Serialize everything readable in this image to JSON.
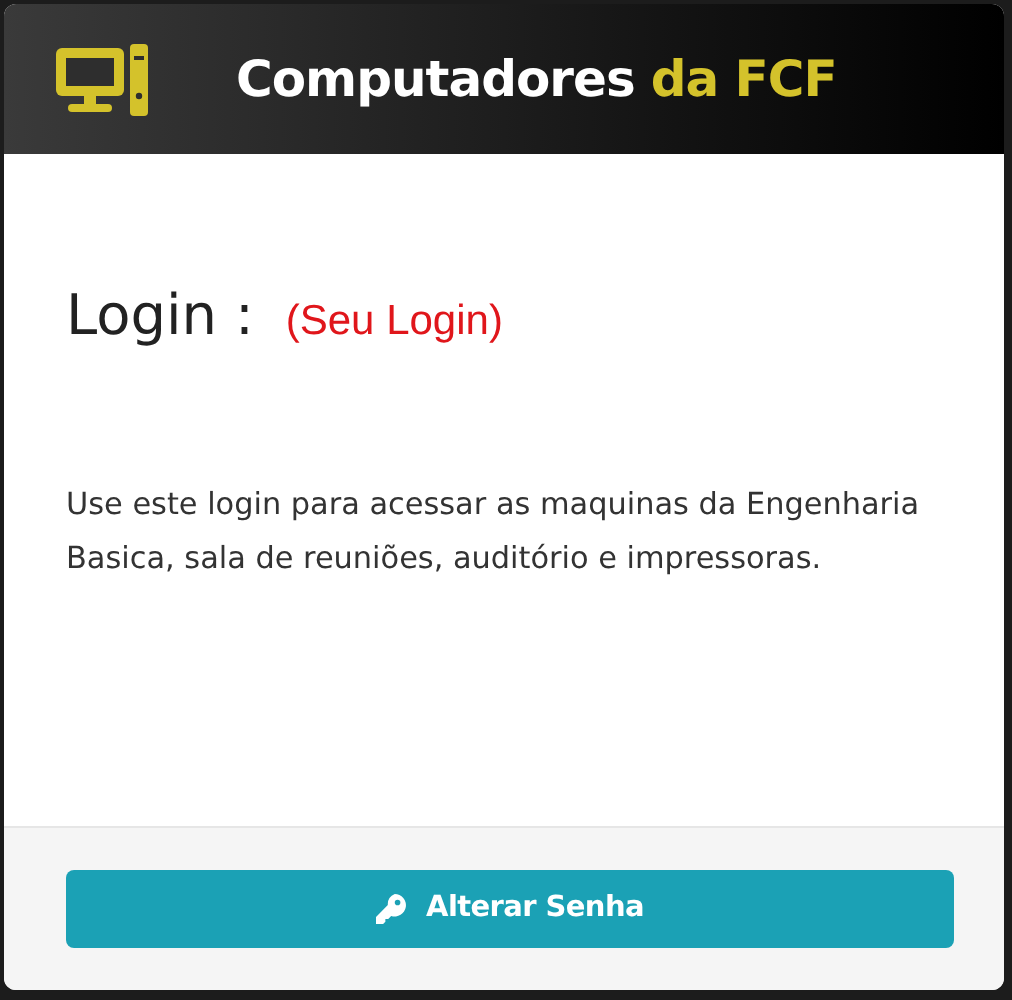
{
  "header": {
    "title": "Computadores",
    "title_accent": "da FCF"
  },
  "login": {
    "label": "Login :",
    "value": "(Seu Login)"
  },
  "description": "Use este login para acessar as maquinas da Engenharia Basica, sala de reuniões, auditório e impressoras.",
  "button": {
    "label": "Alterar Senha"
  }
}
